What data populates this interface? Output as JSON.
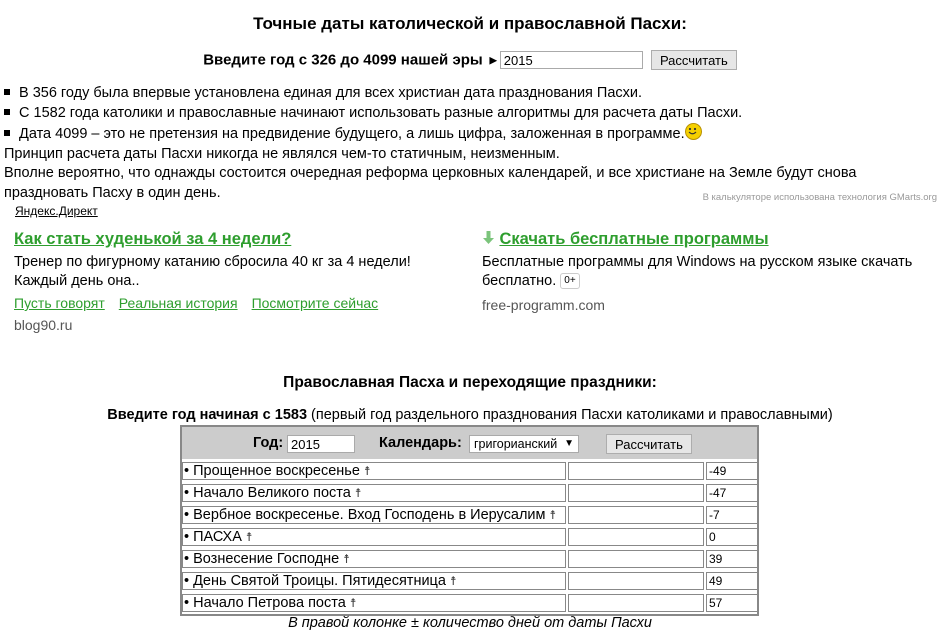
{
  "title": "Точные даты католической и православной Пасхи:",
  "year_prompt": "Введите год с 326 до 4099 нашей эры",
  "year_arrow": "►",
  "year_value": "2015",
  "calc_button": "Рассчитать",
  "bullets": [
    "В 356 году была впервые установлена единая для всех христиан дата празднования Пасхи.",
    "С 1582 года католики и православные начинают использовать разные алгоритмы для расчета даты Пасхи.",
    "Дата 4099 – это не претензия на предвидение будущего, а лишь цифра, заложенная в программе."
  ],
  "para1": "Принцип расчета даты Пасхи никогда не являлся чем-то статичным, неизменным.",
  "para2": "Вполне вероятно, что однажды состоится очередная реформа церковных календарей, и все христиане на Земле будут снова",
  "para3": "праздновать Пасху в один день.",
  "gmarts": "В калькуляторе использована технология GMarts.org",
  "yandex": "Яндекс.Директ",
  "ad1": {
    "title": "Как стать худенькой за 4 недели?",
    "text1": "Тренер по фигурному катанию сбросила 40 кг за 4 недели!",
    "text2": "Каждый день она..",
    "links": [
      "Пусть говорят",
      "Реальная история",
      "Посмотрите сейчас"
    ],
    "host": "blog90.ru"
  },
  "ad2": {
    "title": "Скачать бесплатные программы",
    "text1": "Бесплатные программы для Windows на русском языке скачать",
    "text2": "бесплатно.",
    "badge": "0+",
    "host": "free-programm.com"
  },
  "section2_title": "Православная Пасха и переходящие праздники:",
  "section2_note_bold": "Введите год начиная с 1583",
  "section2_note": " (первый год раздельного празднования Пасхи католиками и православными)",
  "form": {
    "year_label": "Год:",
    "year_value": "2015",
    "calendar_label": "Календарь:",
    "calendar_value": "григорианский",
    "calc_button": "Рассчитать"
  },
  "holidays": [
    {
      "name": "• Прощенное воскресенье",
      "days": "-49"
    },
    {
      "name": "• Начало Великого поста",
      "days": "-47"
    },
    {
      "name": "• Вербное воскресенье. Вход Господень в Иерусалим",
      "days": "-7"
    },
    {
      "name": "• ПАСХА",
      "days": "0"
    },
    {
      "name": "• Вознесение Господне",
      "days": "39"
    },
    {
      "name": "• День Святой Троицы. Пятидесятница",
      "days": "49"
    },
    {
      "name": "• Начало Петрова поста",
      "days": "57"
    }
  ],
  "cross_glyph": "☨",
  "footer": "В правой колонке ± количество дней от даты Пасхи"
}
